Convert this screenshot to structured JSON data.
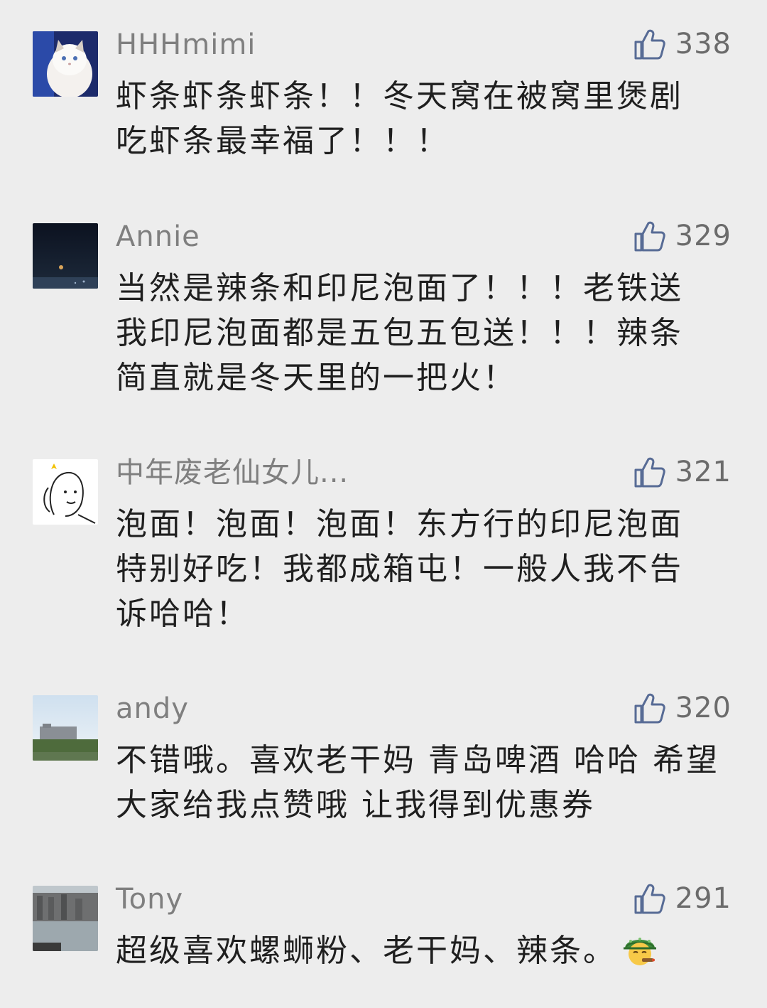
{
  "comments": [
    {
      "nickname": "HHHmimi",
      "likes": "338",
      "avatar": "cat-photo",
      "lines": [
        "虾条虾条虾条！！冬天窝在被窝里煲剧",
        "吃虾条最幸福了！！！"
      ]
    },
    {
      "nickname": "Annie",
      "likes": "329",
      "avatar": "night-sky-photo",
      "lines": [
        "当然是辣条和印尼泡面了！！！老铁送",
        "我印尼泡面都是五包五包送！！！辣条",
        "简直就是冬天里的一把火！"
      ]
    },
    {
      "nickname": "中年废老仙女儿...",
      "likes": "321",
      "avatar": "doodle-face",
      "lines": [
        "泡面！泡面！泡面！东方行的印尼泡面",
        "特别好吃！我都成箱屯！一般人我不告",
        "诉哈哈！"
      ]
    },
    {
      "nickname": "andy",
      "likes": "320",
      "avatar": "building-sky-photo",
      "lines": [
        "不错哦。喜欢老干妈 青岛啤酒 哈哈 希望",
        "大家给我点赞哦 让我得到优惠券"
      ]
    },
    {
      "nickname": "Tony",
      "likes": "291",
      "avatar": "canal-city-photo",
      "lines": [
        "超级喜欢螺蛳粉、老干妈、辣条。"
      ],
      "emoji": "helmet-cigar-emoji"
    }
  ],
  "colors": {
    "background": "#ededed",
    "nickname": "#7f7f7f",
    "body": "#1f1f1f",
    "like_icon": "#576b95"
  }
}
